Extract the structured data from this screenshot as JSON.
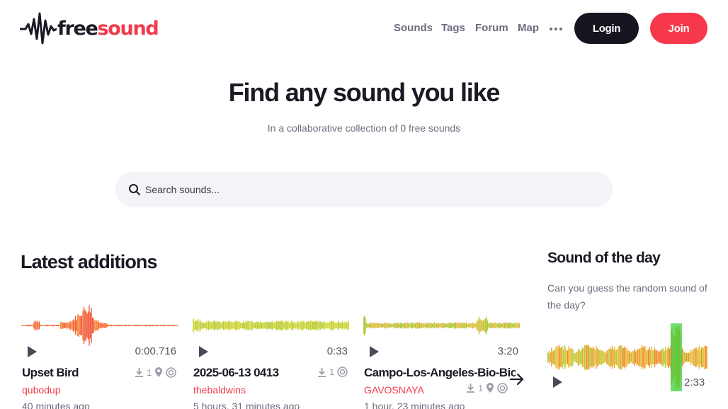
{
  "brand": {
    "free": "free",
    "sound": "sound"
  },
  "nav": {
    "items": [
      "Sounds",
      "Tags",
      "Forum",
      "Map"
    ]
  },
  "auth": {
    "login": "Login",
    "join": "Join"
  },
  "hero": {
    "title": "Find any sound you like",
    "subtitle": "In a collaborative collection of 0 free sounds"
  },
  "search": {
    "placeholder": "Search sounds..."
  },
  "latest": {
    "title": "Latest additions",
    "cards": [
      {
        "name": "Upset Bird",
        "duration": "0:00.716",
        "downloads": "1",
        "user": "qubodup",
        "time": "40 minutes ago",
        "wave_colors": [
          "#f25a3a",
          "#f98a3d"
        ]
      },
      {
        "name": "2025-06-13 0413",
        "duration": "0:33",
        "downloads": "1",
        "user": "thebaldwins",
        "time": "5 hours, 31 minutes ago",
        "wave_colors": [
          "#b8cc3a",
          "#d5d83a"
        ]
      },
      {
        "name": "Campo-Los-Angeles-Bio-Bio",
        "duration": "3:20",
        "downloads": "1",
        "user": "GAVOSNAYA",
        "time": "1 hour, 23 minutes ago",
        "wave_colors": [
          "#f0b93a",
          "#a8c93a"
        ]
      }
    ]
  },
  "sound_of_day": {
    "title": "Sound of the day",
    "description": "Can you guess the random sound of the day?",
    "duration": "2:33"
  },
  "icons": {
    "play": "play-icon",
    "search": "search-icon",
    "download": "download-icon",
    "location": "location-pin-icon",
    "license": "license-icon",
    "arrow": "arrow-right-icon",
    "more": "more-icon"
  }
}
